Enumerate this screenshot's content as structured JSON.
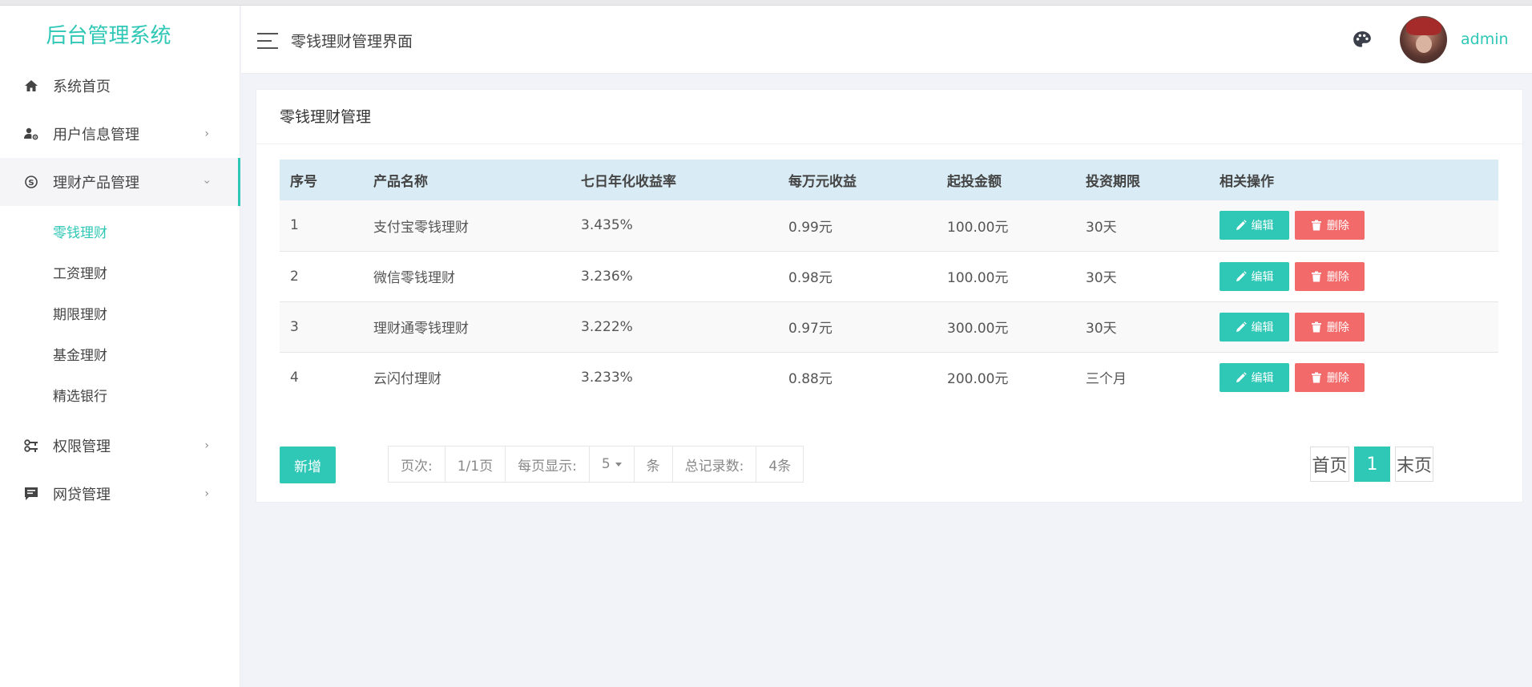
{
  "app": {
    "title": "后台管理系统"
  },
  "sidebar": {
    "items": [
      {
        "label": "系统首页",
        "icon": "home-icon"
      },
      {
        "label": "用户信息管理",
        "icon": "user-gear-icon",
        "chevron": "›"
      },
      {
        "label": "理财产品管理",
        "icon": "skype-icon",
        "chevron": "›",
        "open": true
      },
      {
        "label": "权限管理",
        "icon": "key-icon",
        "chevron": "›"
      },
      {
        "label": "网贷管理",
        "icon": "message-icon",
        "chevron": "›"
      }
    ],
    "subitems": [
      {
        "label": "零钱理财",
        "active": true
      },
      {
        "label": "工资理财"
      },
      {
        "label": "期限理财"
      },
      {
        "label": "基金理财"
      },
      {
        "label": "精选银行"
      }
    ]
  },
  "header": {
    "page_title": "零钱理财管理界面",
    "palette_icon": "palette-icon",
    "username": "admin"
  },
  "panel": {
    "title": "零钱理财管理",
    "columns": [
      "序号",
      "产品名称",
      "七日年化收益率",
      "每万元收益",
      "起投金额",
      "投资期限",
      "相关操作"
    ],
    "rows": [
      [
        "1",
        "支付宝零钱理财",
        "3.435%",
        "0.99元",
        "100.00元",
        "30天"
      ],
      [
        "2",
        "微信零钱理财",
        "3.236%",
        "0.98元",
        "100.00元",
        "30天"
      ],
      [
        "3",
        "理财通零钱理财",
        "3.222%",
        "0.97元",
        "300.00元",
        "30天"
      ],
      [
        "4",
        "云闪付理财",
        "3.233%",
        "0.88元",
        "200.00元",
        "三个月"
      ]
    ],
    "edit_label": "编辑",
    "delete_label": "删除",
    "add_label": "新增"
  },
  "pager": {
    "page_label": "页次:",
    "page_value": "1/1页",
    "per_page_label": "每页显示:",
    "per_page_value": "5",
    "unit_label": "条",
    "total_label": "总记录数:",
    "total_value": "4条",
    "first_label": "首页",
    "current_page": "1",
    "last_label": "末页"
  },
  "colors": {
    "accent": "#2fc7b6",
    "danger": "#f26a6a",
    "table_header": "#d9ecf5"
  }
}
